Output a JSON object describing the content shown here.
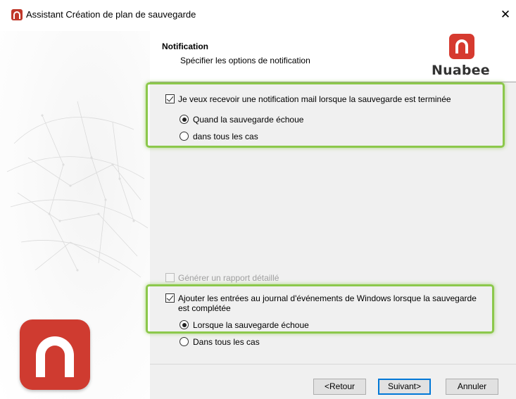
{
  "window": {
    "title": "Assistant Création de plan de sauvegarde",
    "close_glyph": "✕"
  },
  "header": {
    "title": "Notification",
    "subtitle": "Spécifier les options de notification",
    "brand_name": "Nuabee"
  },
  "email_notification": {
    "checkbox_label": "Je veux recevoir une notification mail lorsque la sauvegarde est terminée",
    "checked": true,
    "options": [
      {
        "label": "Quand la sauvegarde échoue",
        "selected": true
      },
      {
        "label": "dans tous les cas",
        "selected": false
      }
    ]
  },
  "detailed_report": {
    "checkbox_label": "Générer un rapport détaillé",
    "checked": false,
    "enabled": false
  },
  "event_log": {
    "checkbox_label_line1": "Ajouter les entrées au journal d'événements de Windows lorsque la sauvegarde",
    "checkbox_label_line2": "est complétée",
    "checked": true,
    "options": [
      {
        "label": "Lorsque la sauvegarde échoue",
        "selected": true
      },
      {
        "label": "Dans tous les cas",
        "selected": false
      }
    ]
  },
  "buttons": {
    "back": "<Retour",
    "next": "Suivant>",
    "cancel": "Annuler"
  },
  "colors": {
    "brand_red": "#d63a2f",
    "highlight_green": "#8cc84b",
    "panel_gray": "#f0f0f0"
  }
}
